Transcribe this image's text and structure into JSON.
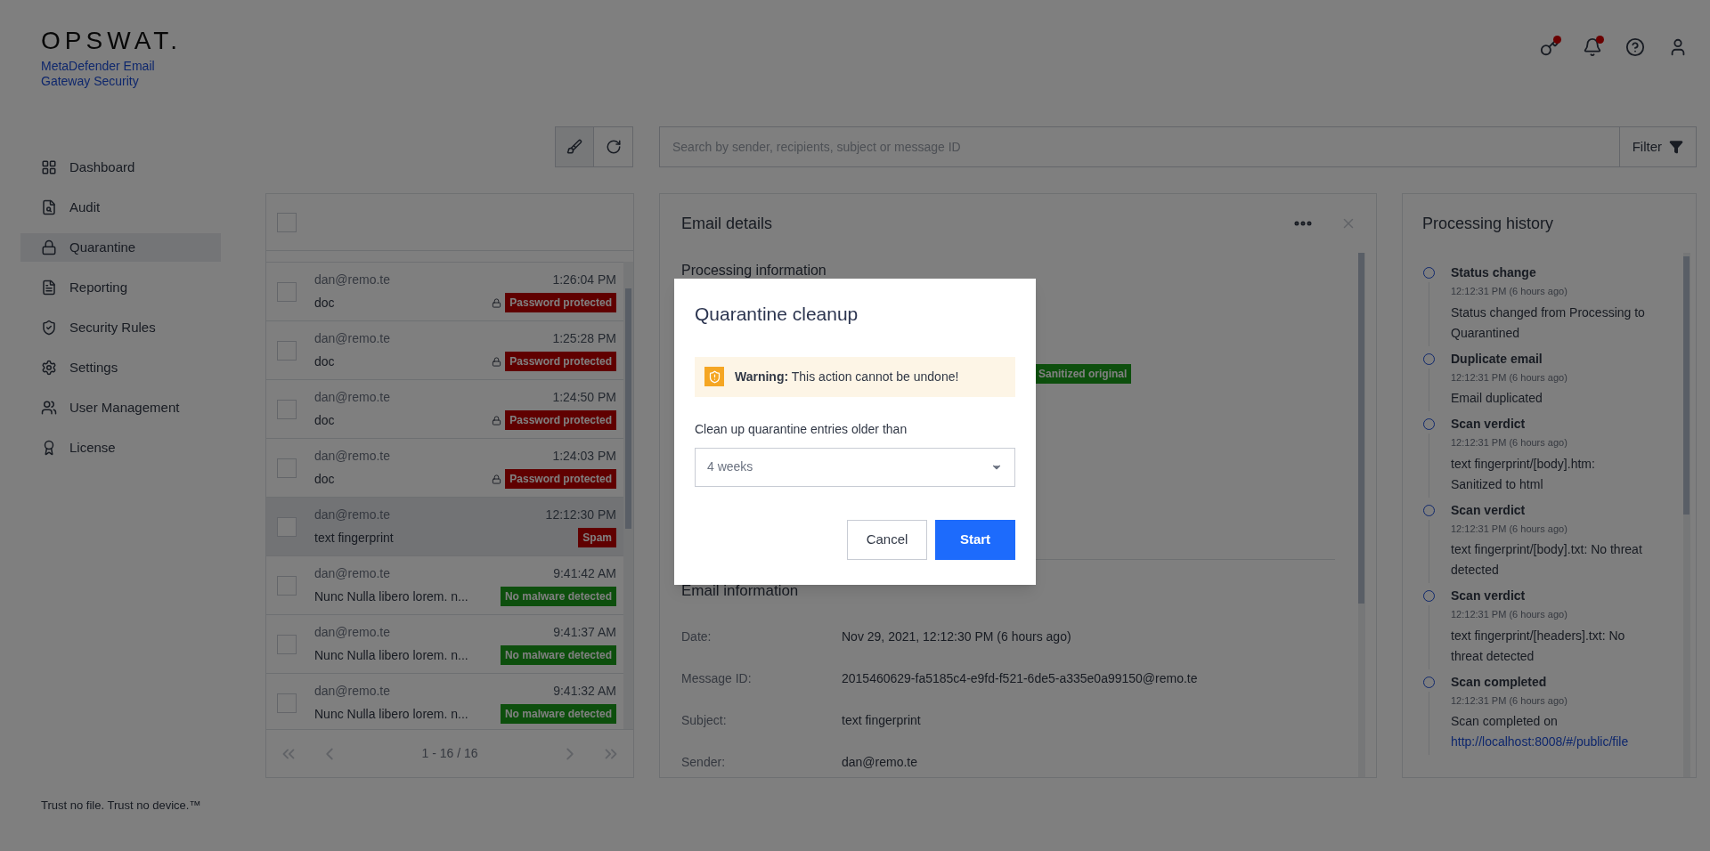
{
  "brand": {
    "logo": "OPSWAT.",
    "product": "MetaDefender Email Gateway Security"
  },
  "header_icons": [
    {
      "kind": "key",
      "badge": true
    },
    {
      "kind": "bell",
      "badge": true
    },
    {
      "kind": "help",
      "badge": false
    },
    {
      "kind": "user",
      "badge": false
    }
  ],
  "sidebar": {
    "items": [
      {
        "label": "Dashboard",
        "selected": false
      },
      {
        "label": "Audit",
        "selected": false
      },
      {
        "label": "Quarantine",
        "selected": true
      },
      {
        "label": "Reporting",
        "selected": false
      },
      {
        "label": "Security Rules",
        "selected": false
      },
      {
        "label": "Settings",
        "selected": false
      },
      {
        "label": "User Management",
        "selected": false
      },
      {
        "label": "License",
        "selected": false
      }
    ]
  },
  "search": {
    "placeholder": "Search by sender, recipients, subject or message ID",
    "filter": "Filter"
  },
  "email_list": {
    "select_all_checked": false,
    "rows": [
      {
        "sender": "dan@remo.te",
        "time": "1:26:04 PM",
        "subject": "doc",
        "locked": true,
        "tag": {
          "label": "Password protected",
          "kind": "danger"
        },
        "checked": false,
        "selected": false
      },
      {
        "sender": "dan@remo.te",
        "time": "1:25:28 PM",
        "subject": "doc",
        "locked": true,
        "tag": {
          "label": "Password protected",
          "kind": "danger"
        },
        "checked": false,
        "selected": false
      },
      {
        "sender": "dan@remo.te",
        "time": "1:24:50 PM",
        "subject": "doc",
        "locked": true,
        "tag": {
          "label": "Password protected",
          "kind": "danger"
        },
        "checked": false,
        "selected": false
      },
      {
        "sender": "dan@remo.te",
        "time": "1:24:03 PM",
        "subject": "doc",
        "locked": true,
        "tag": {
          "label": "Password protected",
          "kind": "danger"
        },
        "checked": false,
        "selected": false
      },
      {
        "sender": "dan@remo.te",
        "time": "12:12:30 PM",
        "subject": "text fingerprint",
        "locked": false,
        "tag": {
          "label": "Spam",
          "kind": "danger"
        },
        "checked": false,
        "selected": true
      },
      {
        "sender": "dan@remo.te",
        "time": "9:41:42 AM",
        "subject": "Nunc Nulla libero lorem. n...",
        "locked": false,
        "tag": {
          "label": "No malware detected",
          "kind": "success"
        },
        "checked": false,
        "selected": false
      },
      {
        "sender": "dan@remo.te",
        "time": "9:41:37 AM",
        "subject": "Nunc Nulla libero lorem. n...",
        "locked": false,
        "tag": {
          "label": "No malware detected",
          "kind": "success"
        },
        "checked": false,
        "selected": false
      },
      {
        "sender": "dan@remo.te",
        "time": "9:41:32 AM",
        "subject": "Nunc Nulla libero lorem. n...",
        "locked": false,
        "tag": {
          "label": "No malware detected",
          "kind": "success"
        },
        "checked": false,
        "selected": false
      }
    ],
    "pagination": "1 - 16 / 16"
  },
  "email_details": {
    "title": "Email details",
    "processing_heading": "Processing information",
    "result_tag": "Sanitized original",
    "info_heading": "Email information",
    "info": [
      {
        "label": "Date:",
        "value": "Nov 29, 2021, 12:12:30 PM (6 hours ago)"
      },
      {
        "label": "Message ID:",
        "value": "2015460629-fa5185c4-e9fd-f521-6de5-a335e0a99150@remo.te"
      },
      {
        "label": "Subject:",
        "value": "text fingerprint"
      },
      {
        "label": "Sender:",
        "value": "dan@remo.te"
      }
    ]
  },
  "processing_history": {
    "title": "Processing history",
    "items": [
      {
        "title": "Status change",
        "time": "12:12:31 PM (6 hours ago)",
        "text": "Status changed from Processing to Quarantined"
      },
      {
        "title": "Duplicate email",
        "time": "12:12:31 PM (6 hours ago)",
        "text": "Email duplicated"
      },
      {
        "title": "Scan verdict",
        "time": "12:12:31 PM (6 hours ago)",
        "text": "text fingerprint/[body].htm: Sanitized to html"
      },
      {
        "title": "Scan verdict",
        "time": "12:12:31 PM (6 hours ago)",
        "text": "text fingerprint/[body].txt: No threat detected"
      },
      {
        "title": "Scan verdict",
        "time": "12:12:31 PM (6 hours ago)",
        "text": "text fingerprint/[headers].txt: No threat detected"
      },
      {
        "title": "Scan completed",
        "time": "12:12:31 PM (6 hours ago)",
        "text": "Scan completed on",
        "link": "http://localhost:8008/#/public/file"
      }
    ]
  },
  "footer": "Trust no file. Trust no device.™",
  "dialog": {
    "title": "Quarantine cleanup",
    "warning": "**Warning:** This action cannot be undone!",
    "field_label": "Clean up quarantine entries older than",
    "select_value": "4 weeks",
    "cancel": "Cancel",
    "start": "Start"
  }
}
